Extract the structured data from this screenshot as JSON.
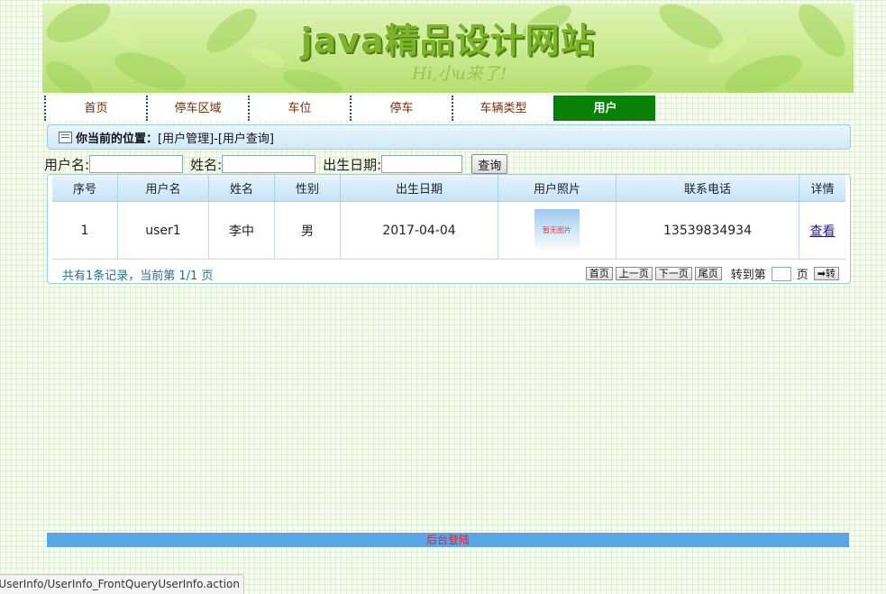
{
  "banner": {
    "title": "java精品设计网站",
    "subtitle": "Hi,小u来了!"
  },
  "nav": {
    "items": [
      {
        "label": "首页"
      },
      {
        "label": "停车区域"
      },
      {
        "label": "车位"
      },
      {
        "label": "停车"
      },
      {
        "label": "车辆类型"
      },
      {
        "label": "用户",
        "active": true
      }
    ]
  },
  "breadcrumb": {
    "label": "你当前的位置：",
    "path": "[用户管理]-[用户查询]"
  },
  "search": {
    "username_label": "用户名:",
    "username_value": "",
    "name_label": "姓名:",
    "name_value": "",
    "birthday_label": "出生日期:",
    "birthday_value": "",
    "query_button": "查询"
  },
  "table": {
    "headers": [
      "序号",
      "用户名",
      "姓名",
      "性别",
      "出生日期",
      "用户照片",
      "联系电话",
      "详情"
    ],
    "rows": [
      {
        "index": "1",
        "username": "user1",
        "name": "李中",
        "gender": "男",
        "birthday": "2017-04-04",
        "photo_text": "暂无图片",
        "phone": "13539834934",
        "detail": "查看"
      }
    ]
  },
  "pager": {
    "summary": "共有1条记录，当前第 1/1 页",
    "first": "首页",
    "prev": "上一页",
    "next": "下一页",
    "last": "尾页",
    "jump_label": "转到第",
    "page_unit": "页",
    "go": "➡转"
  },
  "footer": {
    "admin_link": "后台登陆"
  },
  "status": {
    "url": "UserInfo/UserInfo_FrontQueryUserInfo.action"
  }
}
